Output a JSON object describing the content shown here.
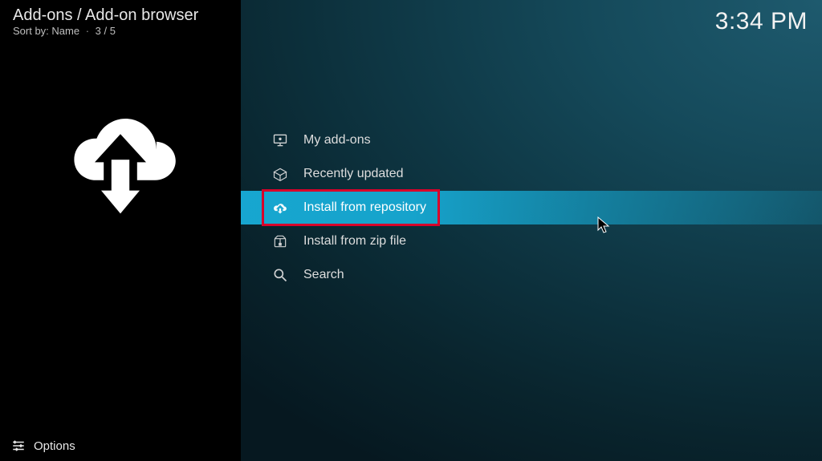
{
  "header": {
    "breadcrumb": "Add-ons / Add-on browser",
    "sort_prefix": "Sort by: ",
    "sort_value": "Name",
    "position": "3 / 5"
  },
  "clock": "3:34 PM",
  "menu": {
    "items": [
      {
        "label": "My add-ons",
        "icon": "monitor-icon",
        "selected": false
      },
      {
        "label": "Recently updated",
        "icon": "open-box-icon",
        "selected": false
      },
      {
        "label": "Install from repository",
        "icon": "cloud-download-icon",
        "selected": true
      },
      {
        "label": "Install from zip file",
        "icon": "zip-file-icon",
        "selected": false
      },
      {
        "label": "Search",
        "icon": "search-icon",
        "selected": false
      }
    ]
  },
  "footer": {
    "options_label": "Options"
  }
}
